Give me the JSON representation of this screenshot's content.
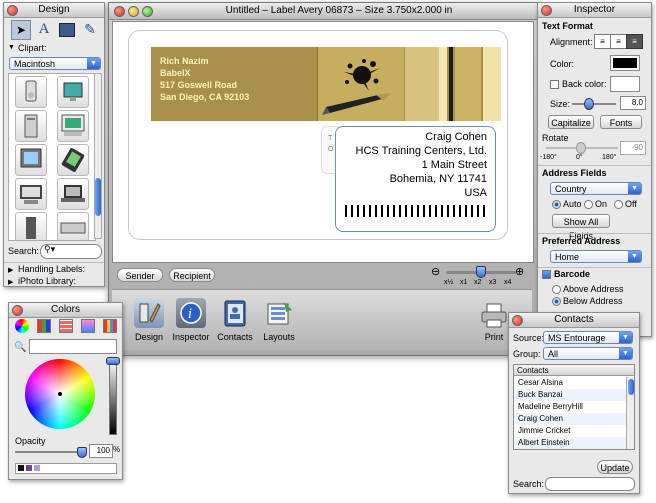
{
  "design_palette": {
    "title": "Design",
    "clipart_label": "Clipart:",
    "clipart_category": "Macintosh",
    "search_label": "Search:",
    "sections": [
      "Handling Labels:",
      "iPhoto Library:"
    ]
  },
  "main_window": {
    "title": "Untitled – Label Avery 06873 – Size 3.750x2.000 in",
    "sender": {
      "name": "Rich Nazim",
      "company": "BabelX",
      "street": "517 Goswell Road",
      "city": "San Diego, CA 92103"
    },
    "recipient": {
      "name": "Craig Cohen",
      "company": "HCS Training Centers, Ltd.",
      "street": "1 Main Street",
      "city": "Bohemia, NY 11741",
      "country": "USA"
    },
    "to_label": "T O",
    "tabs": [
      "Sender",
      "Recipient"
    ],
    "zoom_labels": [
      "x½",
      "x1",
      "x2",
      "x3",
      "x4"
    ],
    "toolbar": {
      "design": "Design",
      "inspector": "Inspector",
      "contacts": "Contacts",
      "layouts": "Layouts",
      "print": "Print"
    }
  },
  "inspector": {
    "title": "Inspector",
    "text_format": "Text Format",
    "alignment": "Alignment:",
    "color": "Color:",
    "back_color": "Back color:",
    "size": "Size:",
    "size_value": "8.0",
    "capitalize": "Capitalize",
    "fonts": "Fonts",
    "rotate": "Rotate",
    "rotate_ticks": [
      "-180°",
      "0°",
      "180°"
    ],
    "rotate_value": "-90",
    "address_fields": "Address Fields",
    "address_country": "Country",
    "auto": "Auto",
    "on": "On",
    "off": "Off",
    "show_all_fields": "Show All Fields",
    "preferred_address": "Preferred Address",
    "preferred_value": "Home",
    "barcode": "Barcode",
    "above_address": "Above Address",
    "below_address": "Below Address"
  },
  "colors_palette": {
    "title": "Colors",
    "opacity": "Opacity",
    "opacity_value": "100",
    "percent": "%"
  },
  "contacts_palette": {
    "title": "Contacts",
    "source_label": "Source:",
    "source_value": "MS Entourage",
    "group_label": "Group:",
    "group_value": "All",
    "list_header": "Contacts",
    "contacts": [
      "Cesar Alsina",
      "Buck Banzai",
      "Madeline BerryHill",
      "Craig Cohen",
      "Jimmie Cricket",
      "Albert Einstein"
    ],
    "update": "Update",
    "search_label": "Search:"
  }
}
